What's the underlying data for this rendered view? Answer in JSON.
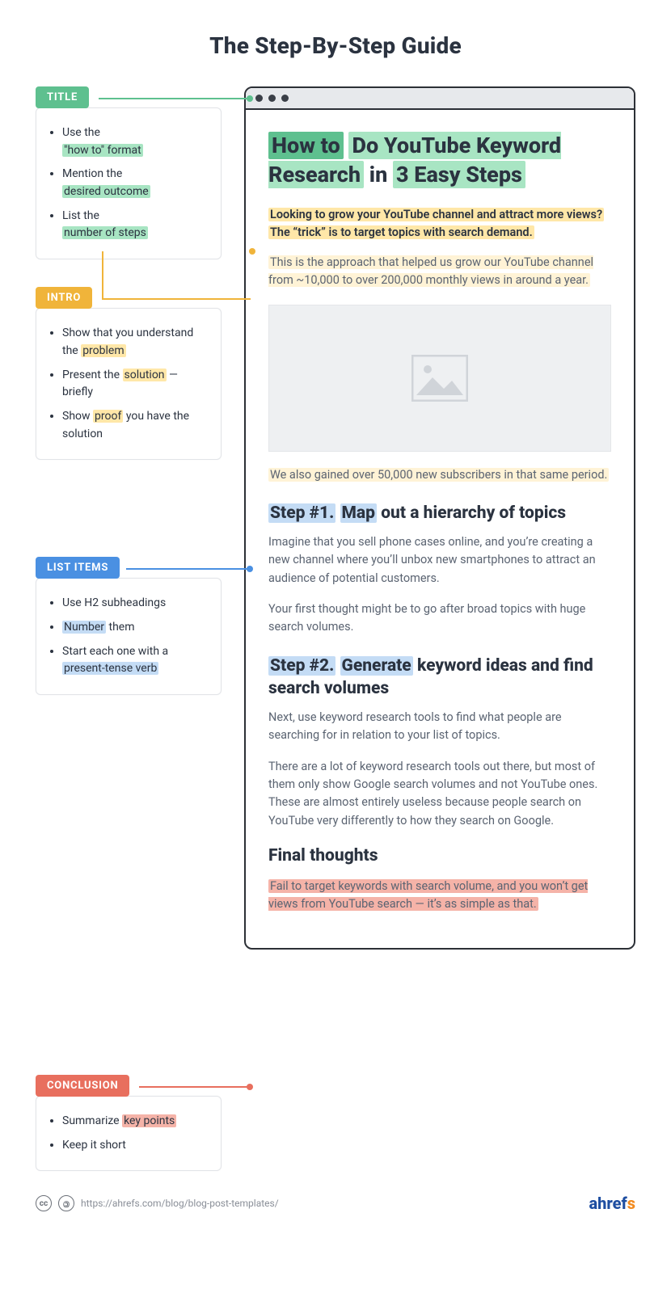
{
  "page_title": "The Step-By-Step Guide",
  "sidebar": {
    "title": {
      "tag": "TITLE",
      "items": [
        {
          "pre": "Use the ",
          "hl": "\"how to\" format",
          "post": ""
        },
        {
          "pre": "Mention the ",
          "hl": "desired outcome",
          "post": ""
        },
        {
          "pre": "List the ",
          "hl": "number of steps",
          "post": ""
        }
      ]
    },
    "intro": {
      "tag": "INTRO",
      "items": [
        {
          "pre": "Show that you understand the ",
          "hl": "problem",
          "post": ""
        },
        {
          "pre": "Present the ",
          "hl": "solution",
          "post": " — briefly"
        },
        {
          "pre": "Show ",
          "hl": "proof",
          "post": " you have the solution"
        }
      ]
    },
    "list_items": {
      "tag": "LIST ITEMS",
      "items_plain": [
        "Use H2 subheadings"
      ],
      "items_hl": [
        {
          "pre": "",
          "hl": "Number",
          "post": " them"
        },
        {
          "pre": "Start each one with a ",
          "hl": "present-tense verb",
          "post": ""
        }
      ]
    },
    "conclusion": {
      "tag": "CONCLUSION",
      "items": [
        {
          "pre": "Summarize ",
          "hl": "key points",
          "post": ""
        },
        {
          "pre": "Keep it short",
          "hl": "",
          "post": ""
        }
      ]
    }
  },
  "post": {
    "title_parts": {
      "p1": "How to",
      "p2": "Do YouTube Keyword Research",
      "p3": "in",
      "p4": "3 Easy Steps"
    },
    "intro1": "Looking to grow your YouTube channel and attract more views?",
    "intro2": "The “trick” is to target topics with search demand.",
    "proof1": "This is the approach that helped us grow our YouTube channel from ~10,000 to over 200,000 monthly views in around a year.",
    "proof2": "We also gained over 50,000 new subscribers in that same period.",
    "step1": {
      "num": "Step #1.",
      "verb": "Map",
      "rest": "out a hierarchy of topics",
      "p1": "Imagine that you sell phone cases online, and you’re creating a new channel where you’ll unbox new smartphones to attract an audience of potential customers.",
      "p2": "Your first thought might be to go after broad topics with huge search volumes."
    },
    "step2": {
      "num": "Step #2.",
      "verb": "Generate",
      "rest": "keyword ideas and find search volumes",
      "p1": "Next, use keyword research tools to find what people are searching for in relation to your list of topics.",
      "p2": "There are a lot of keyword research tools out there, but most of them only show Google search volumes and not YouTube ones. These are almost entirely useless because people search on YouTube very differently to how they search on Google."
    },
    "final": {
      "h": "Final thoughts",
      "p": "Fail to target keywords with search volume, and you won’t get views from YouTube search — it’s as simple as that."
    }
  },
  "footer": {
    "url": "https://ahrefs.com/blog/blog-post-templates/",
    "brand": "ahrefs"
  }
}
